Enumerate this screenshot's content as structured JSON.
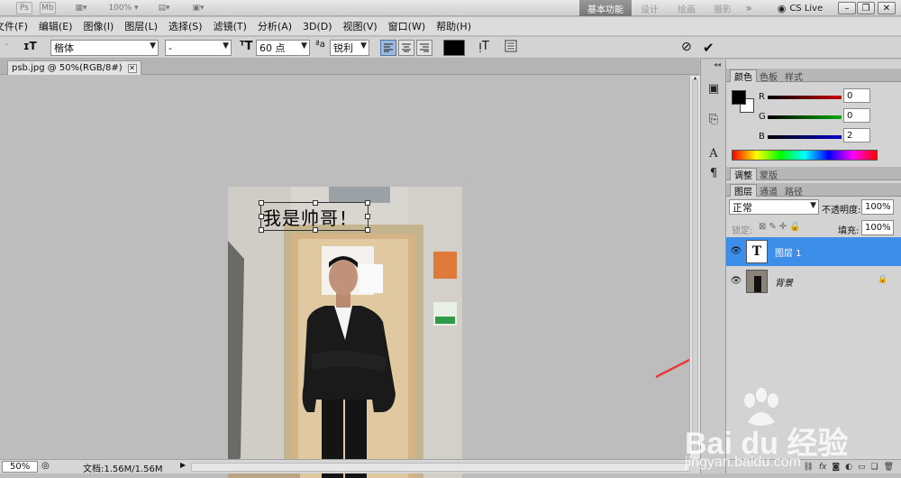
{
  "appbar": {
    "ps_label": "Ps",
    "mb_label": "Mb",
    "zoom": "100%",
    "workspaces": [
      "基本功能",
      "设计",
      "绘画",
      "摄影"
    ],
    "more": "»",
    "cslive": "CS Live"
  },
  "menu": [
    "文件(F)",
    "编辑(E)",
    "图像(I)",
    "图层(L)",
    "选择(S)",
    "滤镜(T)",
    "分析(A)",
    "3D(D)",
    "视图(V)",
    "窗口(W)",
    "帮助(H)"
  ],
  "options": {
    "font_family": "楷体",
    "font_style": "-",
    "font_size": "60 点",
    "aa_label": "a",
    "aa_mode": "锐利"
  },
  "document": {
    "tab_title": "psb.jpg @ 50%(RGB/8#)",
    "text_layer_content": "我是帅哥！"
  },
  "status": {
    "zoom": "50%",
    "doc_size": "文档:1.56M/1.56M"
  },
  "color_panel": {
    "tabs": [
      "颜色",
      "色板",
      "样式"
    ],
    "r_label": "R",
    "g_label": "G",
    "b_label": "B",
    "r": "0",
    "g": "0",
    "b": "2"
  },
  "adjust_panel": {
    "tabs": [
      "调整",
      "蒙版"
    ]
  },
  "layers_panel": {
    "tabs": [
      "图层",
      "通道",
      "路径"
    ],
    "blend_mode": "正常",
    "opacity_label": "不透明度:",
    "opacity": "100%",
    "lock_label": "锁定:",
    "fill_label": "填充:",
    "fill": "100%",
    "layers": [
      {
        "name": "图层 1",
        "thumb": "T",
        "selected": true
      },
      {
        "name": "背景",
        "selected": false
      }
    ],
    "bottom_icons": [
      "link-icon",
      "fx-icon",
      "mask-icon",
      "adjustment-icon",
      "folder-icon",
      "new-layer-icon",
      "trash-icon"
    ]
  },
  "watermark": {
    "brand": "Bai du 经验",
    "url": "jingyan.baidu.com"
  },
  "colors": {
    "selected_layer": "#3d8ee8",
    "r_slider": "#cc0000",
    "g_slider": "#00aa00",
    "b_slider": "#0000cc",
    "annotation_arrow": "#e8383d"
  }
}
